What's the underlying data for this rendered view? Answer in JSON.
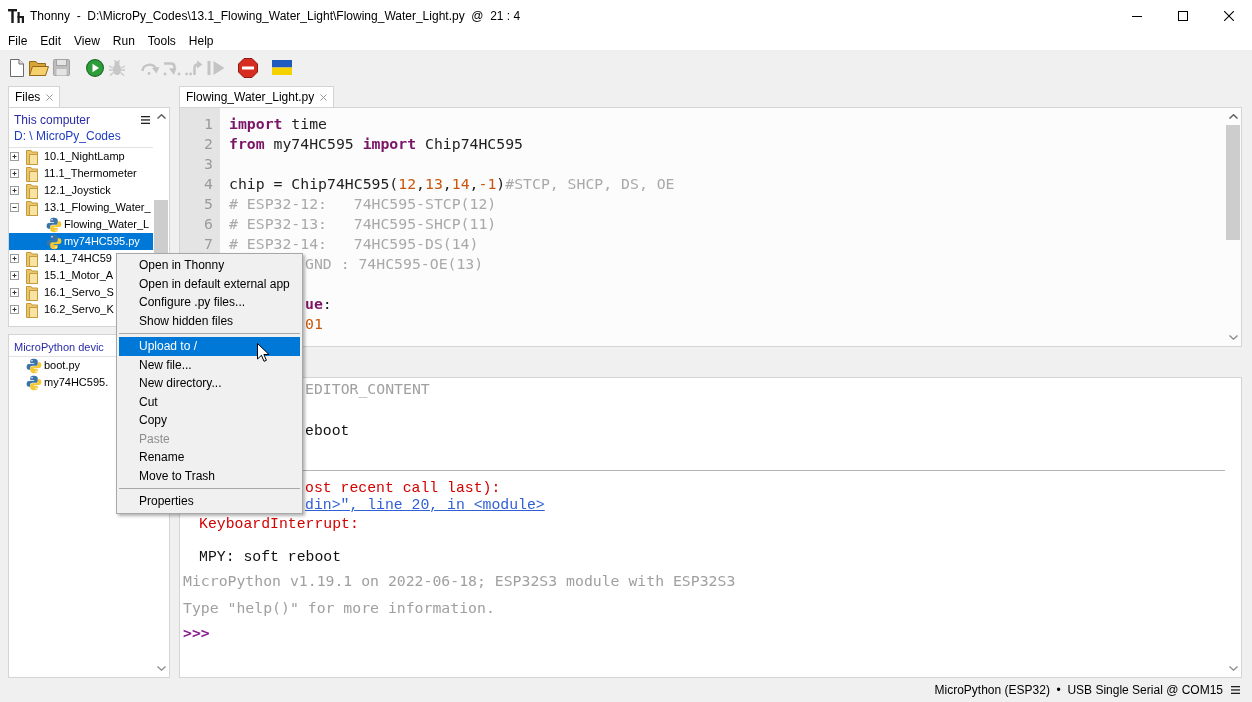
{
  "window": {
    "title": "Thonny  -  D:\\MicroPy_Codes\\13.1_Flowing_Water_Light\\Flowing_Water_Light.py  @  21 : 4"
  },
  "menu_bar": [
    "File",
    "Edit",
    "View",
    "Run",
    "Tools",
    "Help"
  ],
  "toolbar": [
    {
      "disabled": false
    },
    {
      "disabled": false
    },
    {
      "disabled": true
    },
    {
      "disabled": false
    },
    {
      "disabled": true
    },
    {
      "disabled": true
    },
    {
      "disabled": true
    },
    {
      "disabled": true
    },
    {
      "disabled": true
    },
    {
      "disabled": false
    },
    {
      "disabled": false
    }
  ],
  "files_panel": {
    "tab": {
      "label": "Files",
      "selected": true
    },
    "location": "This computer",
    "path": "D: \\ MicroPy_Codes",
    "tree": [
      {
        "label": "10.1_NightLamp",
        "kind": "folder",
        "expanded": false,
        "selected": false
      },
      {
        "label": "11.1_Thermometer",
        "kind": "folder",
        "expanded": false,
        "selected": false
      },
      {
        "label": "12.1_Joystick",
        "kind": "folder",
        "expanded": false,
        "selected": false
      },
      {
        "label": "13.1_Flowing_Water_",
        "kind": "folder",
        "expanded": true,
        "selected": false,
        "children": [
          {
            "label": "Flowing_Water_L",
            "kind": "file",
            "selected": false
          },
          {
            "label": "my74HC595.py",
            "kind": "file",
            "selected": true
          }
        ]
      },
      {
        "label": "14.1_74HC59",
        "kind": "folder",
        "expanded": false,
        "selected": false
      },
      {
        "label": "15.1_Motor_A",
        "kind": "folder",
        "expanded": false,
        "selected": false
      },
      {
        "label": "16.1_Servo_S",
        "kind": "folder",
        "expanded": false,
        "selected": false
      },
      {
        "label": "16.2_Servo_K",
        "kind": "folder",
        "expanded": false,
        "selected": false
      }
    ]
  },
  "device_panel": {
    "title": "MicroPython devic",
    "files": [
      {
        "label": "boot.py",
        "kind": "file",
        "selected": false
      },
      {
        "label": "my74HC595.",
        "kind": "file",
        "selected": false
      }
    ]
  },
  "editor": {
    "tab": {
      "label": "Flowing_Water_Light.py",
      "selected": true
    },
    "lines": [
      {
        "kind": "code",
        "number": "1",
        "tokens": [
          {
            "kind": "keyword",
            "text": "import"
          },
          {
            "kind": "plain",
            "text": " time"
          }
        ]
      },
      {
        "kind": "code",
        "number": "2",
        "tokens": [
          {
            "kind": "keyword",
            "text": "from"
          },
          {
            "kind": "plain",
            "text": " my74HC595 "
          },
          {
            "kind": "keyword",
            "text": "import"
          },
          {
            "kind": "plain",
            "text": " Chip74HC595"
          }
        ]
      },
      {
        "kind": "blank",
        "number": "3"
      },
      {
        "kind": "code",
        "number": "4",
        "tokens": [
          {
            "kind": "plain",
            "text": "chip = Chip74HC595("
          },
          {
            "kind": "number",
            "text": "12"
          },
          {
            "kind": "plain",
            "text": ","
          },
          {
            "kind": "number",
            "text": "13"
          },
          {
            "kind": "plain",
            "text": ","
          },
          {
            "kind": "number",
            "text": "14"
          },
          {
            "kind": "plain",
            "text": ","
          },
          {
            "kind": "number",
            "text": "-1"
          },
          {
            "kind": "plain",
            "text": ")"
          },
          {
            "kind": "comment",
            "text": "#STCP, SHCP, DS, OE"
          }
        ]
      },
      {
        "kind": "code",
        "number": "5",
        "tokens": [
          {
            "kind": "comment",
            "text": "# ESP32-12:   74HC595-STCP(12)"
          }
        ]
      },
      {
        "kind": "code",
        "number": "6",
        "tokens": [
          {
            "kind": "comment",
            "text": "# ESP32-13:   74HC595-SHCP(11)"
          }
        ]
      },
      {
        "kind": "code",
        "number": "7",
        "tokens": [
          {
            "kind": "comment",
            "text": "# ESP32-14:   74HC595-DS(14)"
          }
        ]
      },
      {
        "kind": "code",
        "tokens": [
          {
            "kind": "comment",
            "text": "GND : 74HC595-OE(13)"
          }
        ]
      },
      {
        "kind": "blank"
      },
      {
        "kind": "code",
        "tokens": [
          {
            "kind": "keyword",
            "text": "ue"
          },
          {
            "kind": "plain",
            "text": ":"
          }
        ]
      },
      {
        "kind": "code",
        "tokens": [
          {
            "kind": "number",
            "text": "01"
          }
        ]
      }
    ]
  },
  "shell": {
    "lines": [
      {
        "kind": "command",
        "text": "EDITOR_CONTENT",
        "behind_menu": true
      },
      {
        "kind": "output",
        "text": "eboot",
        "behind_menu": true
      },
      {
        "kind": "error",
        "text": "ost recent call last):",
        "behind_menu": true
      },
      {
        "kind": "link",
        "text": "din>\", line 20, in <module>",
        "behind_menu": true
      },
      {
        "kind": "error",
        "text": "KeyboardInterrupt:"
      },
      {
        "kind": "output",
        "text": "MPY: soft reboot"
      },
      {
        "kind": "info",
        "text": "MicroPython v1.19.1 on 2022-06-18; ESP32S3 module with ESP32S3"
      },
      {
        "kind": "info",
        "text": "Type \"help()\" for more information."
      },
      {
        "kind": "prompt",
        "text": ">>>"
      }
    ]
  },
  "context_menu": {
    "items": [
      {
        "kind": "item",
        "label": "Open in Thonny",
        "selected": false,
        "disabled": false
      },
      {
        "kind": "item",
        "label": "Open in default external app",
        "selected": false,
        "disabled": false
      },
      {
        "kind": "item",
        "label": "Configure .py files...",
        "selected": false,
        "disabled": false
      },
      {
        "kind": "item",
        "label": "Show hidden files",
        "selected": false,
        "disabled": false
      },
      {
        "kind": "separator"
      },
      {
        "kind": "item",
        "label": "Upload to /",
        "selected": true,
        "disabled": false
      },
      {
        "kind": "item",
        "label": "New file...",
        "selected": false,
        "disabled": false
      },
      {
        "kind": "item",
        "label": "New directory...",
        "selected": false,
        "disabled": false
      },
      {
        "kind": "item",
        "label": "Cut",
        "selected": false,
        "disabled": false
      },
      {
        "kind": "item",
        "label": "Copy",
        "selected": false,
        "disabled": false
      },
      {
        "kind": "item",
        "label": "Paste",
        "selected": false,
        "disabled": true
      },
      {
        "kind": "item",
        "label": "Rename",
        "selected": false,
        "disabled": false
      },
      {
        "kind": "item",
        "label": "Move to Trash",
        "selected": false,
        "disabled": false
      },
      {
        "kind": "separator"
      },
      {
        "kind": "item",
        "label": "Properties",
        "selected": false,
        "disabled": false
      }
    ]
  },
  "status_bar": {
    "interpreter": "MicroPython (ESP32)  •  USB Single Serial @ COM15"
  }
}
